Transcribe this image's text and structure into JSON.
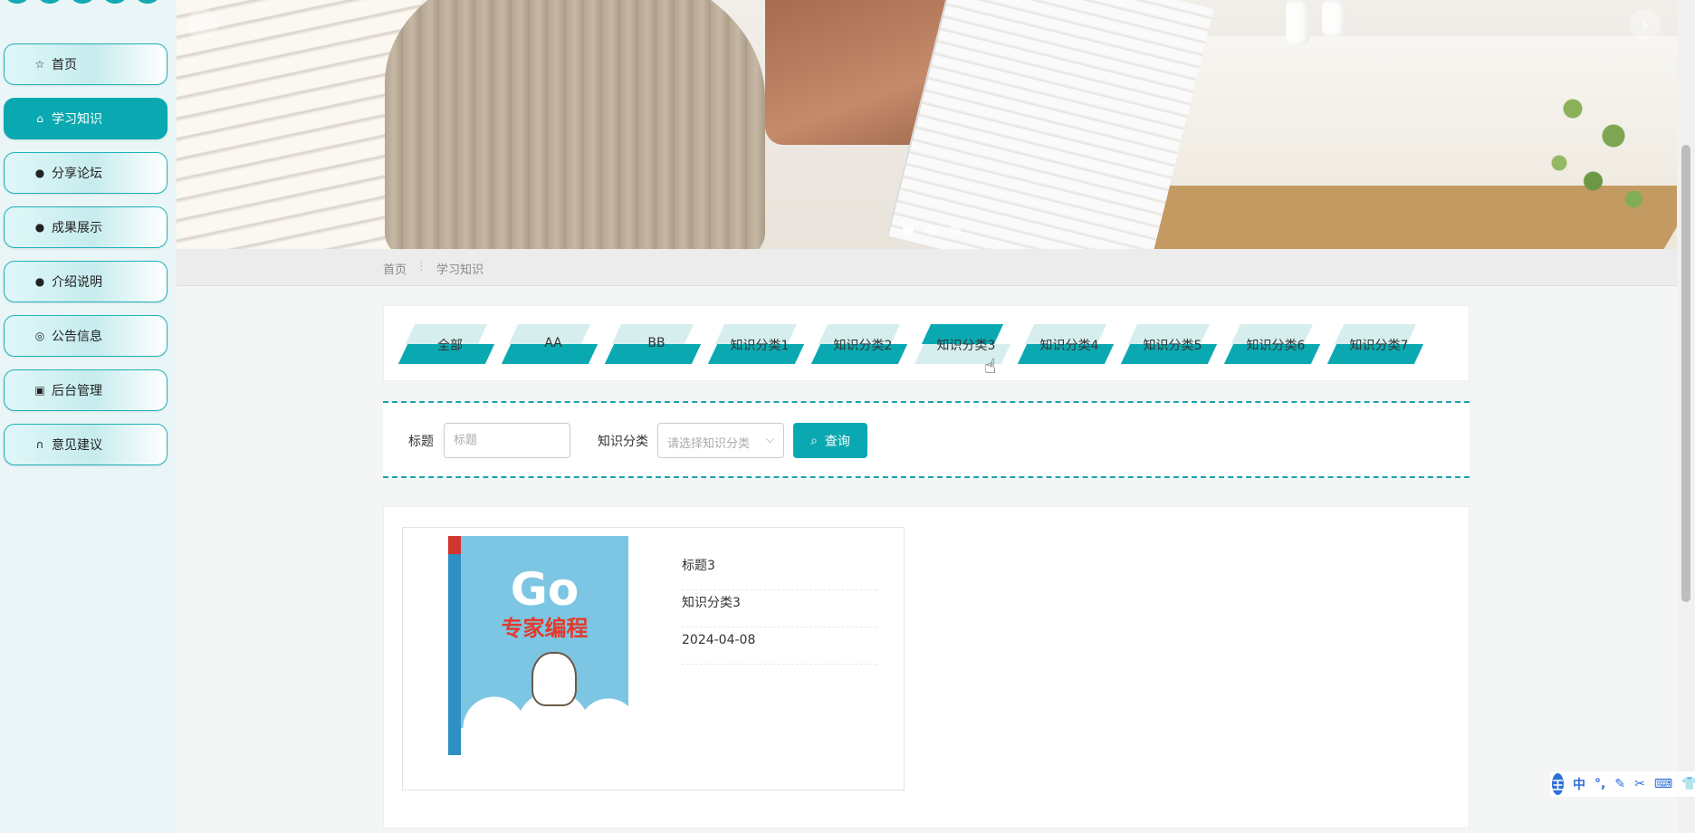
{
  "sidebar": {
    "items": [
      {
        "label": "首页",
        "icon": "star-icon",
        "glyph": "☆"
      },
      {
        "label": "学习知识",
        "icon": "bag-icon",
        "glyph": "⌂"
      },
      {
        "label": "分享论坛",
        "icon": "alert-icon",
        "glyph": "●"
      },
      {
        "label": "成果展示",
        "icon": "question-icon",
        "glyph": "●"
      },
      {
        "label": "介绍说明",
        "icon": "info-icon",
        "glyph": "●"
      },
      {
        "label": "公告信息",
        "icon": "target-icon",
        "glyph": "◎"
      },
      {
        "label": "后台管理",
        "icon": "briefcase-icon",
        "glyph": "▣"
      },
      {
        "label": "意见建议",
        "icon": "headset-icon",
        "glyph": "∩"
      }
    ],
    "active_index": 1
  },
  "banner": {
    "prev_glyph": "‹",
    "next_glyph": "›",
    "dot_count": 3,
    "active_dot": 0
  },
  "breadcrumb": {
    "home": "首页",
    "separator": "⋮",
    "current": "学习知识"
  },
  "categories": {
    "items": [
      "全部",
      "AA",
      "BB",
      "知识分类1",
      "知识分类2",
      "知识分类3",
      "知识分类4",
      "知识分类5",
      "知识分类6",
      "知识分类7"
    ],
    "active_index": 5
  },
  "search": {
    "title_label": "标题",
    "title_placeholder": "标题",
    "title_value": "",
    "category_label": "知识分类",
    "category_placeholder": "请选择知识分类",
    "button_label": "查询"
  },
  "results": [
    {
      "title": "标题3",
      "category": "知识分类3",
      "date": "2024-04-08",
      "cover": {
        "title": "Go",
        "subtitle": "专家编程"
      }
    }
  ],
  "ime": {
    "logo": "王",
    "mode": "中",
    "items": [
      "°,",
      "✎",
      "✂",
      "⌨",
      "👕"
    ]
  },
  "colors": {
    "accent": "#0aa9b1",
    "accent_light": "#d6efee",
    "sidebar_bg": "#e9f5f6"
  }
}
